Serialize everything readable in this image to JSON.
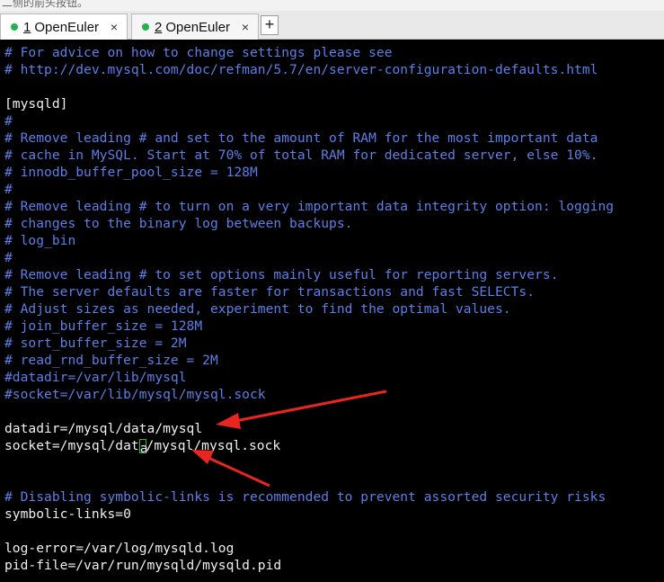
{
  "window": {
    "top_strip_text": "二侧的前头按钮。"
  },
  "tabs": [
    {
      "number": "1",
      "label": "OpenEuler",
      "close": "×",
      "status_color": "#22b14c",
      "active": true
    },
    {
      "number": "2",
      "label": "OpenEuler",
      "close": "×",
      "status_color": "#22b14c",
      "active": false
    }
  ],
  "new_tab_label": "+",
  "terminal": {
    "lines": [
      {
        "text": "# For advice on how to change settings please see",
        "kind": "comment"
      },
      {
        "text": "# http://dev.mysql.com/doc/refman/5.7/en/server-configuration-defaults.html",
        "kind": "comment"
      },
      {
        "text": "",
        "kind": "blank"
      },
      {
        "text": "[mysqld]",
        "kind": "plain"
      },
      {
        "text": "#",
        "kind": "comment"
      },
      {
        "text": "# Remove leading # and set to the amount of RAM for the most important data",
        "kind": "comment"
      },
      {
        "text": "# cache in MySQL. Start at 70% of total RAM for dedicated server, else 10%.",
        "kind": "comment"
      },
      {
        "text": "# innodb_buffer_pool_size = 128M",
        "kind": "comment"
      },
      {
        "text": "#",
        "kind": "comment"
      },
      {
        "text": "# Remove leading # to turn on a very important data integrity option: logging",
        "kind": "comment"
      },
      {
        "text": "# changes to the binary log between backups.",
        "kind": "comment"
      },
      {
        "text": "# log_bin",
        "kind": "comment"
      },
      {
        "text": "#",
        "kind": "comment"
      },
      {
        "text": "# Remove leading # to set options mainly useful for reporting servers.",
        "kind": "comment"
      },
      {
        "text": "# The server defaults are faster for transactions and fast SELECTs.",
        "kind": "comment"
      },
      {
        "text": "# Adjust sizes as needed, experiment to find the optimal values.",
        "kind": "comment"
      },
      {
        "text": "# join_buffer_size = 128M",
        "kind": "comment"
      },
      {
        "text": "# sort_buffer_size = 2M",
        "kind": "comment"
      },
      {
        "text": "# read_rnd_buffer_size = 2M",
        "kind": "comment"
      },
      {
        "text": "#datadir=/var/lib/mysql",
        "kind": "comment"
      },
      {
        "text": "#socket=/var/lib/mysql/mysql.sock",
        "kind": "comment"
      },
      {
        "text": "",
        "kind": "blank"
      },
      {
        "text": "datadir=/mysql/data/mysql",
        "kind": "plain"
      },
      {
        "text": "socket=/mysql/data/mysql/mysql.sock",
        "kind": "plain",
        "before_cursor": "socket=/mysql/dat",
        "cursor_char": "a",
        "after_cursor": "/mysql/mysql.sock"
      },
      {
        "text": "",
        "kind": "blank"
      },
      {
        "text": "",
        "kind": "blank"
      },
      {
        "text": "# Disabling symbolic-links is recommended to prevent assorted security risks",
        "kind": "comment"
      },
      {
        "text": "symbolic-links=0",
        "kind": "plain"
      },
      {
        "text": "",
        "kind": "blank"
      },
      {
        "text": "log-error=/var/log/mysqld.log",
        "kind": "plain"
      },
      {
        "text": "pid-file=/var/run/mysqld/mysqld.pid",
        "kind": "plain"
      }
    ],
    "colors": {
      "background": "#000000",
      "comment": "#5c7fe8",
      "plain": "#f0f0f0",
      "cursor": "#21c521",
      "annotation_arrow": "#e8261f"
    }
  }
}
